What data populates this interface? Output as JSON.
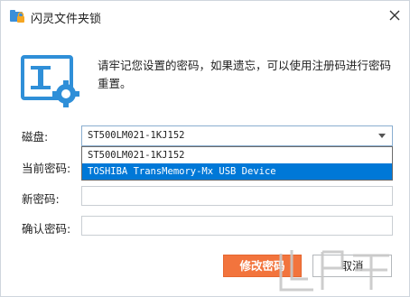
{
  "window": {
    "title": "闪灵文件夹锁",
    "close_icon": "close-icon"
  },
  "message": "请牢记您设置的密码，如果遗忘，可以使用注册码进行密码重置。",
  "disk": {
    "label": "磁盘:",
    "value": "ST500LM021-1KJ152",
    "options": [
      "ST500LM021-1KJ152",
      "TOSHIBA TransMemory-Mx USB Device"
    ],
    "selected_index": 1
  },
  "fields": {
    "current_password_label": "当前密码:",
    "new_password_label": "新密码:",
    "confirm_password_label": "确认密码:",
    "current_password_value": "",
    "new_password_value": "",
    "confirm_password_value": ""
  },
  "buttons": {
    "modify": "修改密码",
    "cancel": "取消"
  },
  "colors": {
    "accent": "#2f8fd8",
    "primary_button": "#f2743d",
    "selection": "#0078d7"
  }
}
